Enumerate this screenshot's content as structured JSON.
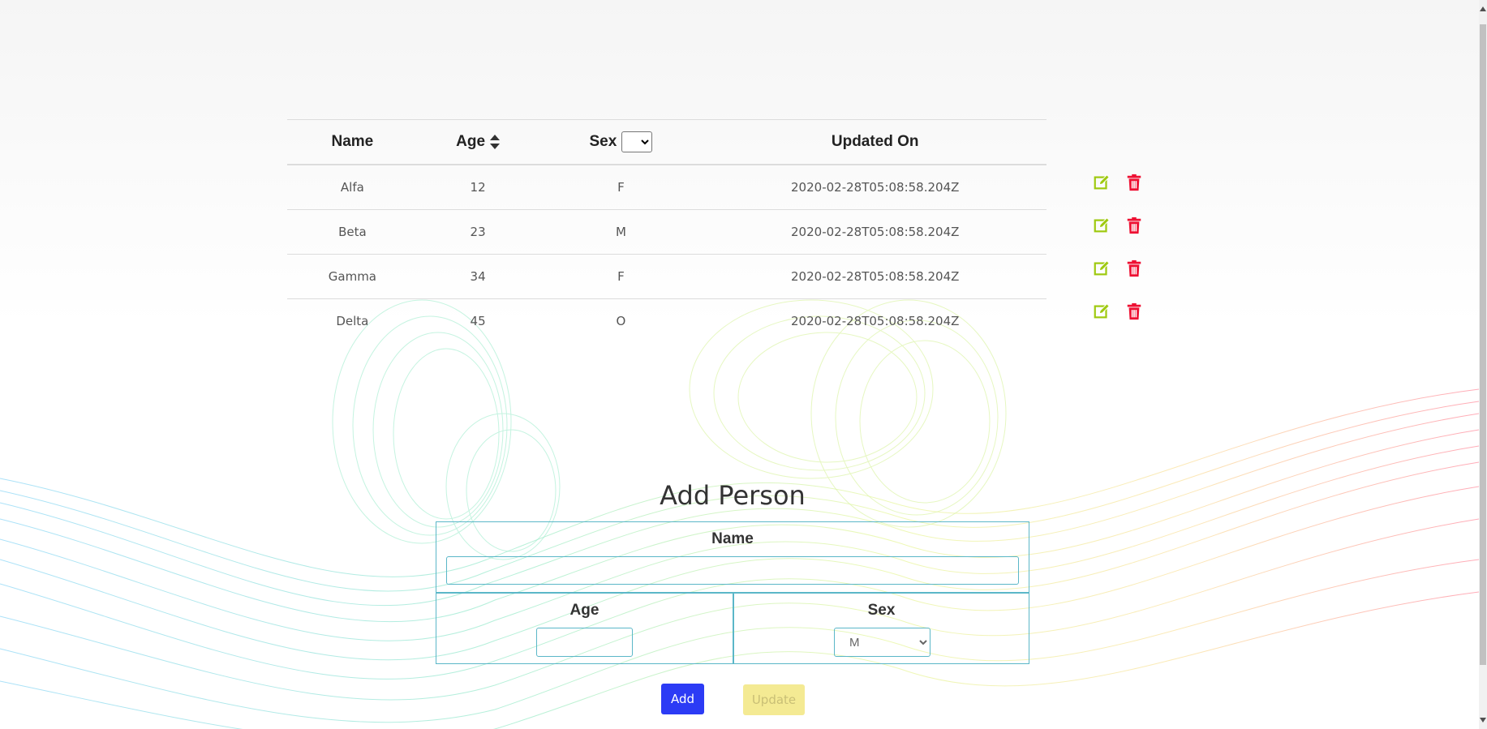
{
  "table": {
    "headers": {
      "name": "Name",
      "age": "Age",
      "sex": "Sex",
      "updated": "Updated On"
    },
    "rows": [
      {
        "name": "Alfa",
        "age": "12",
        "sex": "F",
        "updated": "2020-02-28T05:08:58.204Z"
      },
      {
        "name": "Beta",
        "age": "23",
        "sex": "M",
        "updated": "2020-02-28T05:08:58.204Z"
      },
      {
        "name": "Gamma",
        "age": "34",
        "sex": "F",
        "updated": "2020-02-28T05:08:58.204Z"
      },
      {
        "name": "Delta",
        "age": "45",
        "sex": "O",
        "updated": "2020-02-28T05:08:58.204Z"
      }
    ],
    "sex_filter_value": "",
    "icons": {
      "sort": "sort-icon",
      "edit": "edit-icon",
      "delete": "trash-icon"
    }
  },
  "form": {
    "title": "Add Person",
    "name_label": "Name",
    "name_value": "",
    "age_label": "Age",
    "age_value": "",
    "sex_label": "Sex",
    "sex_value": "M",
    "add_label": "Add",
    "update_label": "Update"
  },
  "colors": {
    "edit": "#9ec90f",
    "delete": "#ee1133",
    "add_button": "#2c3bf5",
    "update_button": "#f4ea93",
    "form_border": "#5bb7c8"
  }
}
